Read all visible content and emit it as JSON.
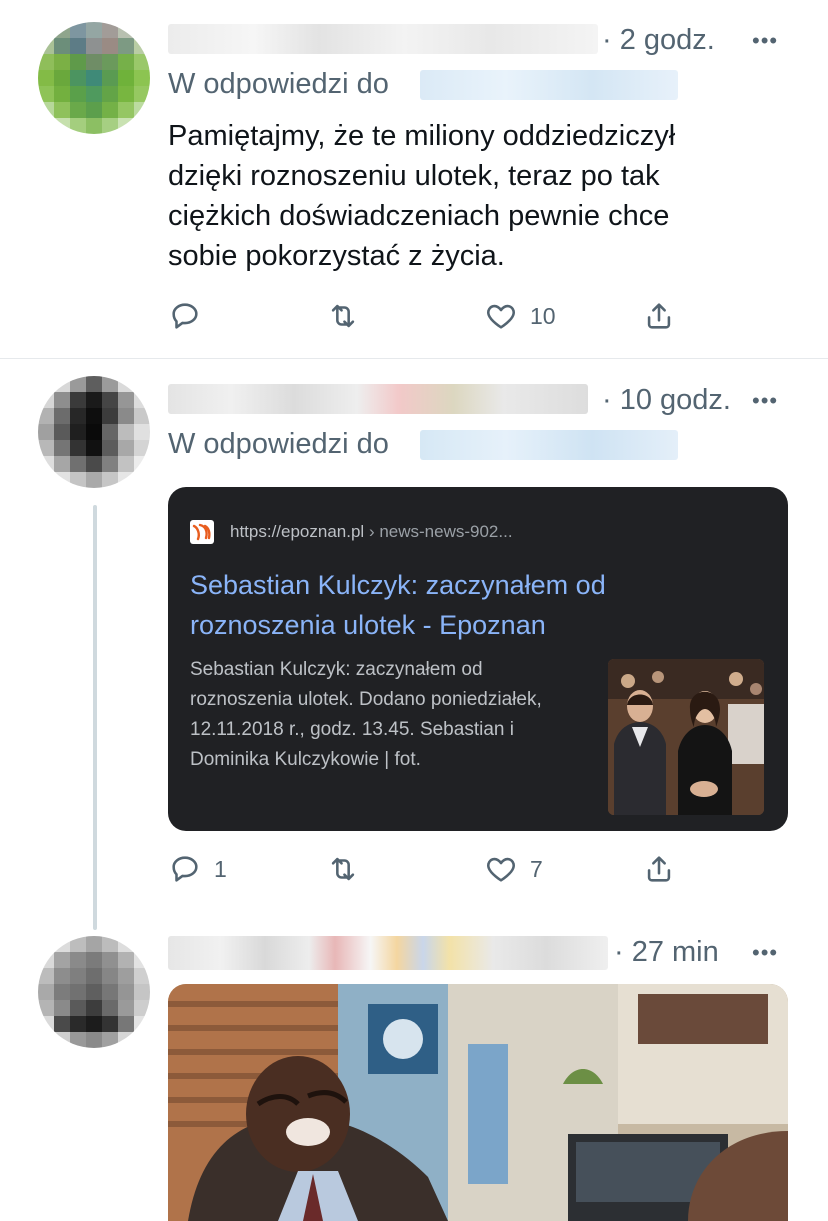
{
  "tweets": [
    {
      "time": "· 2 godz.",
      "more": "•••",
      "reply_prefix": "W odpowiedzi do",
      "text_lines": [
        "Pamiętajmy, że te miliony oddziedziczył",
        "dzięki roznoszeniu ulotek, teraz po tak",
        "ciężkich doświadczeniach pewnie chce",
        "sobie pokorzystać z życia."
      ],
      "actions": {
        "reply": "",
        "retweet": "",
        "like": "10",
        "share": ""
      }
    },
    {
      "time": "· 10 godz.",
      "more": "•••",
      "reply_prefix": "W odpowiedzi do",
      "card": {
        "url": "https://epoznan.pl",
        "path": " › news-news-902...",
        "title_lines": [
          "Sebastian Kulczyk: zaczynałem od",
          "roznoszenia ulotek - Epoznan"
        ],
        "snippet_lines": [
          "Sebastian Kulczyk: zaczynałem od",
          "roznoszenia ulotek. Dodano poniedziałek,",
          "12.11.2018 r., godz. 13.45. Sebastian i",
          "Dominika Kulczykowie | fot."
        ]
      },
      "actions": {
        "reply": "1",
        "retweet": "",
        "like": "7",
        "share": ""
      }
    },
    {
      "time": "· 27 min",
      "more": "•••"
    }
  ],
  "colors": {
    "text": "#0f1419",
    "secondary": "#536471",
    "card_bg": "#202124",
    "card_link": "#8ab4f8",
    "card_text": "#bdc1c6"
  },
  "icons": [
    "reply-icon",
    "retweet-icon",
    "like-icon",
    "share-icon",
    "more-icon",
    "site-favicon"
  ]
}
